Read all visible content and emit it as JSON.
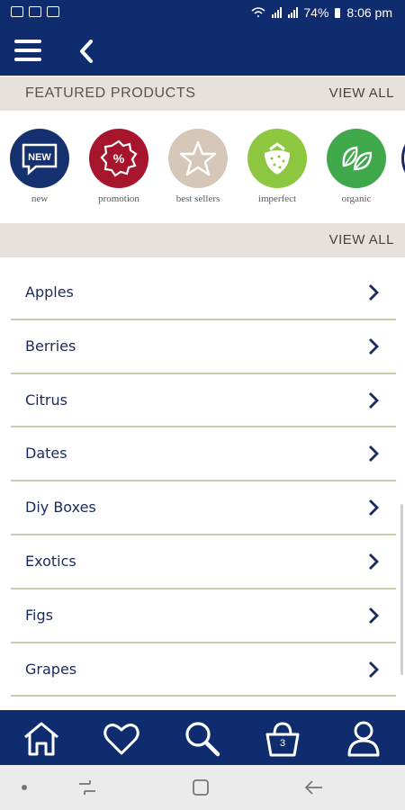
{
  "status_bar": {
    "battery": "74%",
    "time": "8:06 pm"
  },
  "featured": {
    "title": "FEATURED PRODUCTS",
    "view_all": "VIEW ALL",
    "items": [
      {
        "label": "new",
        "icon": "new-badge-icon",
        "color": "#15306f"
      },
      {
        "label": "promotion",
        "icon": "percent-badge-icon",
        "color": "#a6152b"
      },
      {
        "label": "best sellers",
        "icon": "star-icon",
        "color": "#d6c8b8"
      },
      {
        "label": "imperfect",
        "icon": "strawberry-icon",
        "color": "#8dc63f"
      },
      {
        "label": "organic",
        "icon": "leaves-icon",
        "color": "#3ea84a"
      }
    ]
  },
  "categories": {
    "view_all": "VIEW ALL",
    "items": [
      "Apples",
      "Berries",
      "Citrus",
      "Dates",
      "Diy Boxes",
      "Exotics",
      "Figs",
      "Grapes"
    ]
  },
  "bottom_nav": {
    "items": [
      {
        "name": "home-icon"
      },
      {
        "name": "heart-icon"
      },
      {
        "name": "search-icon"
      },
      {
        "name": "basket-icon",
        "badge": "3"
      },
      {
        "name": "account-icon"
      }
    ]
  },
  "colors": {
    "brand": "#0f2d6e",
    "section_bg": "#e6e1dc",
    "divider": "#c9cdb0",
    "text": "#1b2a5c"
  }
}
